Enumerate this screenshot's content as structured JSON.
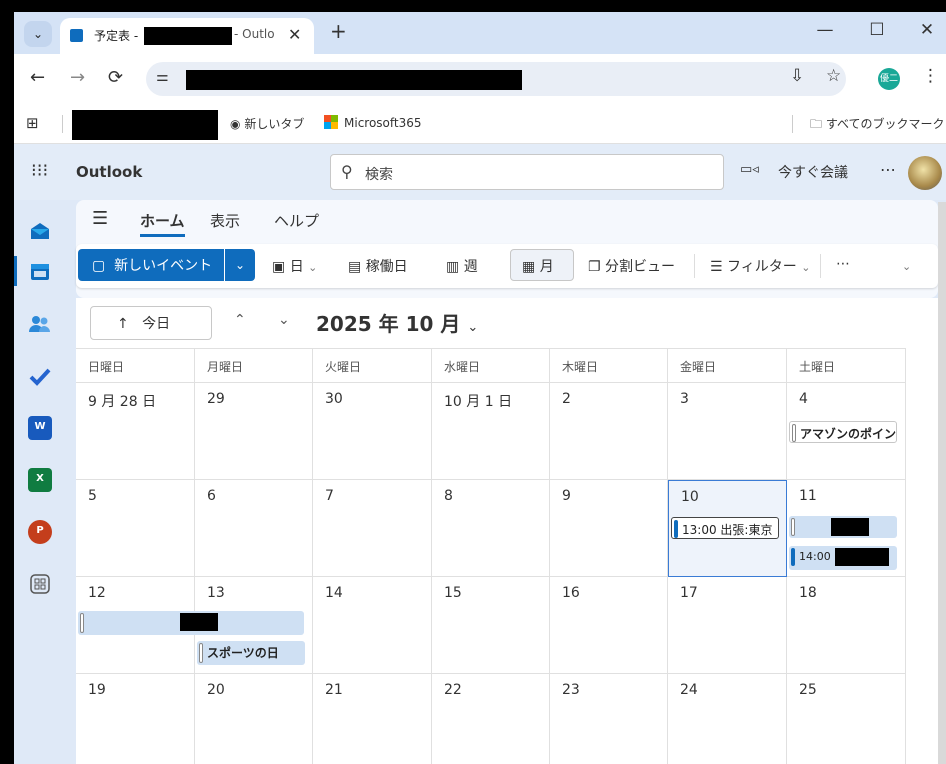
{
  "browser": {
    "tab_menu_icon": "chevron-down-icon",
    "tab": {
      "title_prefix": "予定表 - ",
      "title_suffix": " - Outlo",
      "close": "✕"
    },
    "new_tab": "+",
    "window": {
      "minimize": "—",
      "maximize": "☐",
      "close": "✕"
    },
    "nav": {
      "back": "←",
      "forward": "→",
      "reload": "⟳"
    },
    "toolbar_icons": {
      "install": "⇩",
      "star": "☆",
      "menu": "⋮"
    },
    "profile_initial": "優二"
  },
  "bookmarks": {
    "items": [
      {
        "label": "新しいタブ",
        "icon": "chrome-icon"
      },
      {
        "label": "Microsoft365",
        "icon": "microsoft-logo"
      }
    ],
    "all_bookmarks": "すべてのブックマーク"
  },
  "outlook": {
    "app_title": "Outlook",
    "search_placeholder": "検索",
    "meet_now": "今すぐ会議",
    "more": "⋯"
  },
  "menu_tabs": [
    {
      "label": "ホーム",
      "active": true
    },
    {
      "label": "表示",
      "active": false
    },
    {
      "label": "ヘルプ",
      "active": false
    }
  ],
  "ribbon": {
    "new_event": "新しいイベント",
    "day": "日",
    "work_week": "稼働日",
    "week": "週",
    "month": "月",
    "split_view": "分割ビュー",
    "filter": "フィルター",
    "more": "⋯"
  },
  "calendar": {
    "today_button": "今日",
    "month_title": "2025 年 10 月",
    "weekdays": [
      "日曜日",
      "月曜日",
      "火曜日",
      "水曜日",
      "木曜日",
      "金曜日",
      "土曜日"
    ],
    "weeks": [
      [
        "9 月 28 日",
        "29",
        "30",
        "10 月 1 日",
        "2",
        "3",
        "4"
      ],
      [
        "5",
        "6",
        "7",
        "8",
        "9",
        "10",
        "11"
      ],
      [
        "12",
        "13",
        "14",
        "15",
        "16",
        "17",
        "18"
      ],
      [
        "19",
        "20",
        "21",
        "22",
        "23",
        "24",
        "25"
      ]
    ],
    "today": "10",
    "events": {
      "amazon": "アマゾンのポイント",
      "trip": "13:00 出張:東京",
      "time_1400": "14:00",
      "sports_day": "スポーツの日"
    },
    "accent_color": "#0f6cbd"
  }
}
